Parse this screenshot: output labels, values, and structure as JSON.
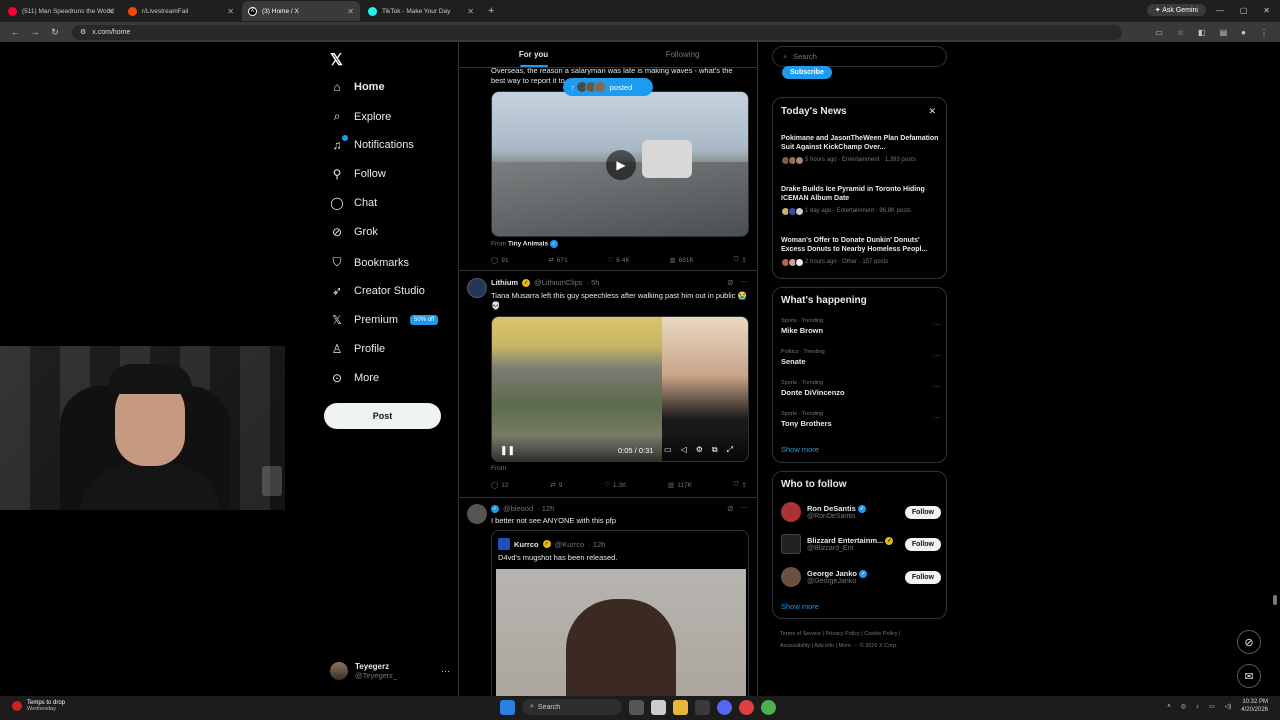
{
  "browser": {
    "tabs": [
      {
        "label": "(511) Man Speedruns the World",
        "color": "#ff0033"
      },
      {
        "label": "r/LivestreamFail",
        "color": "#ff4500"
      },
      {
        "label": "(3) Home / X",
        "color": "#ffffff"
      },
      {
        "label": "TikTok - Make Your Day",
        "color": "#25f4ee"
      }
    ],
    "new_tab": "+",
    "ask_gemini": "Ask Gemini",
    "url": "x.com/home"
  },
  "nav": {
    "items": [
      {
        "label": "Home",
        "icon": "home-icon"
      },
      {
        "label": "Explore",
        "icon": "search-icon"
      },
      {
        "label": "Notifications",
        "icon": "bell-icon"
      },
      {
        "label": "Follow",
        "icon": "person-add-icon"
      },
      {
        "label": "Chat",
        "icon": "chat-icon"
      },
      {
        "label": "Grok",
        "icon": "grok-icon"
      },
      {
        "label": "Bookmarks",
        "icon": "bookmark-icon"
      },
      {
        "label": "Creator Studio",
        "icon": "rocket-icon"
      },
      {
        "label": "Premium",
        "icon": "x-icon"
      },
      {
        "label": "Profile",
        "icon": "person-icon"
      },
      {
        "label": "More",
        "icon": "more-icon"
      }
    ],
    "premium_badge": "50% off",
    "notifications_badge": "3",
    "post_label": "Post",
    "account": {
      "name": "Teyegerz",
      "handle": "@Teyegerz_"
    }
  },
  "feed": {
    "tabs": [
      "For you",
      "Following"
    ],
    "posted_pill": "posted",
    "tweet1": {
      "text": "Overseas, the reason a salaryman was late is making waves - what's the best way to report it to your boss?",
      "from_prefix": "From",
      "from_name": "Tiny Animals",
      "stats": [
        "91",
        "671",
        "6.4K",
        "681K"
      ]
    },
    "tweet2": {
      "name": "Lithium",
      "handle": "@LithiumClips",
      "time": "· 5h",
      "text": "Tiana Musarra left this guy speechless after walking past him out in public 😭💀",
      "video_time": "0:05 / 0:31",
      "from_prefix": "From",
      "stats": [
        "12",
        "9",
        "1.3K",
        "117K"
      ]
    },
    "tweet3": {
      "handle": "@bieood",
      "time": "· 12h",
      "text": "I better not see ANYONE with this pfp",
      "quote_name": "Kurrco",
      "quote_handle": "@Kurrco",
      "quote_time": "· 12h",
      "quote_text": "D4vd's mugshot has been released."
    }
  },
  "right": {
    "search_placeholder": "Search",
    "subscribe": "Subscribe",
    "news_title": "Today's News",
    "news": [
      {
        "headline": "Pokimane and JasonTheWeen Plan Defamation Suit Against KickChamp Over...",
        "meta": "5 hours ago · Entertainment · 1,393 posts"
      },
      {
        "headline": "Drake Builds Ice Pyramid in Toronto Hiding ICEMAN Album Date",
        "meta": "1 day ago · Entertainment · 96.8K posts"
      },
      {
        "headline": "Woman's Offer to Donate Dunkin' Donuts' Excess Donuts to Nearby Homeless Peopl...",
        "meta": "2 hours ago · Other · 157 posts"
      }
    ],
    "happening_title": "What's happening",
    "trends": [
      {
        "context": "Sports · Trending",
        "topic": "Mike Brown"
      },
      {
        "context": "Politics · Trending",
        "topic": "Senate"
      },
      {
        "context": "Sports · Trending",
        "topic": "Donte DiVincenzo"
      },
      {
        "context": "Sports · Trending",
        "topic": "Tony Brothers"
      }
    ],
    "show_more": "Show more",
    "wtf_title": "Who to follow",
    "who_to_follow": [
      {
        "name": "Ron DeSantis",
        "handle": "@RonDeSantis",
        "color": "#a33"
      },
      {
        "name": "Blizzard Entertainm...",
        "handle": "@Blizzard_Ent",
        "color": "#222"
      },
      {
        "name": "George Janko",
        "handle": "@GeorgeJanko",
        "color": "#6b5040"
      }
    ],
    "follow_label": "Follow",
    "footer": [
      "Terms of Service",
      "Privacy Policy",
      "Cookie Policy",
      "Accessibility",
      "Ads info",
      "More ···",
      "© 2026 X Corp."
    ]
  },
  "taskbar": {
    "weather_title": "Temps to drop",
    "weather_day": "Wednesday",
    "search": "Search",
    "time": "10:32 PM",
    "date": "4/20/2026"
  },
  "colors": {
    "accent": "#1d9bf0",
    "bg": "#000000",
    "text": "#e7e9ea",
    "muted": "#71767b",
    "border": "#2f3336"
  }
}
